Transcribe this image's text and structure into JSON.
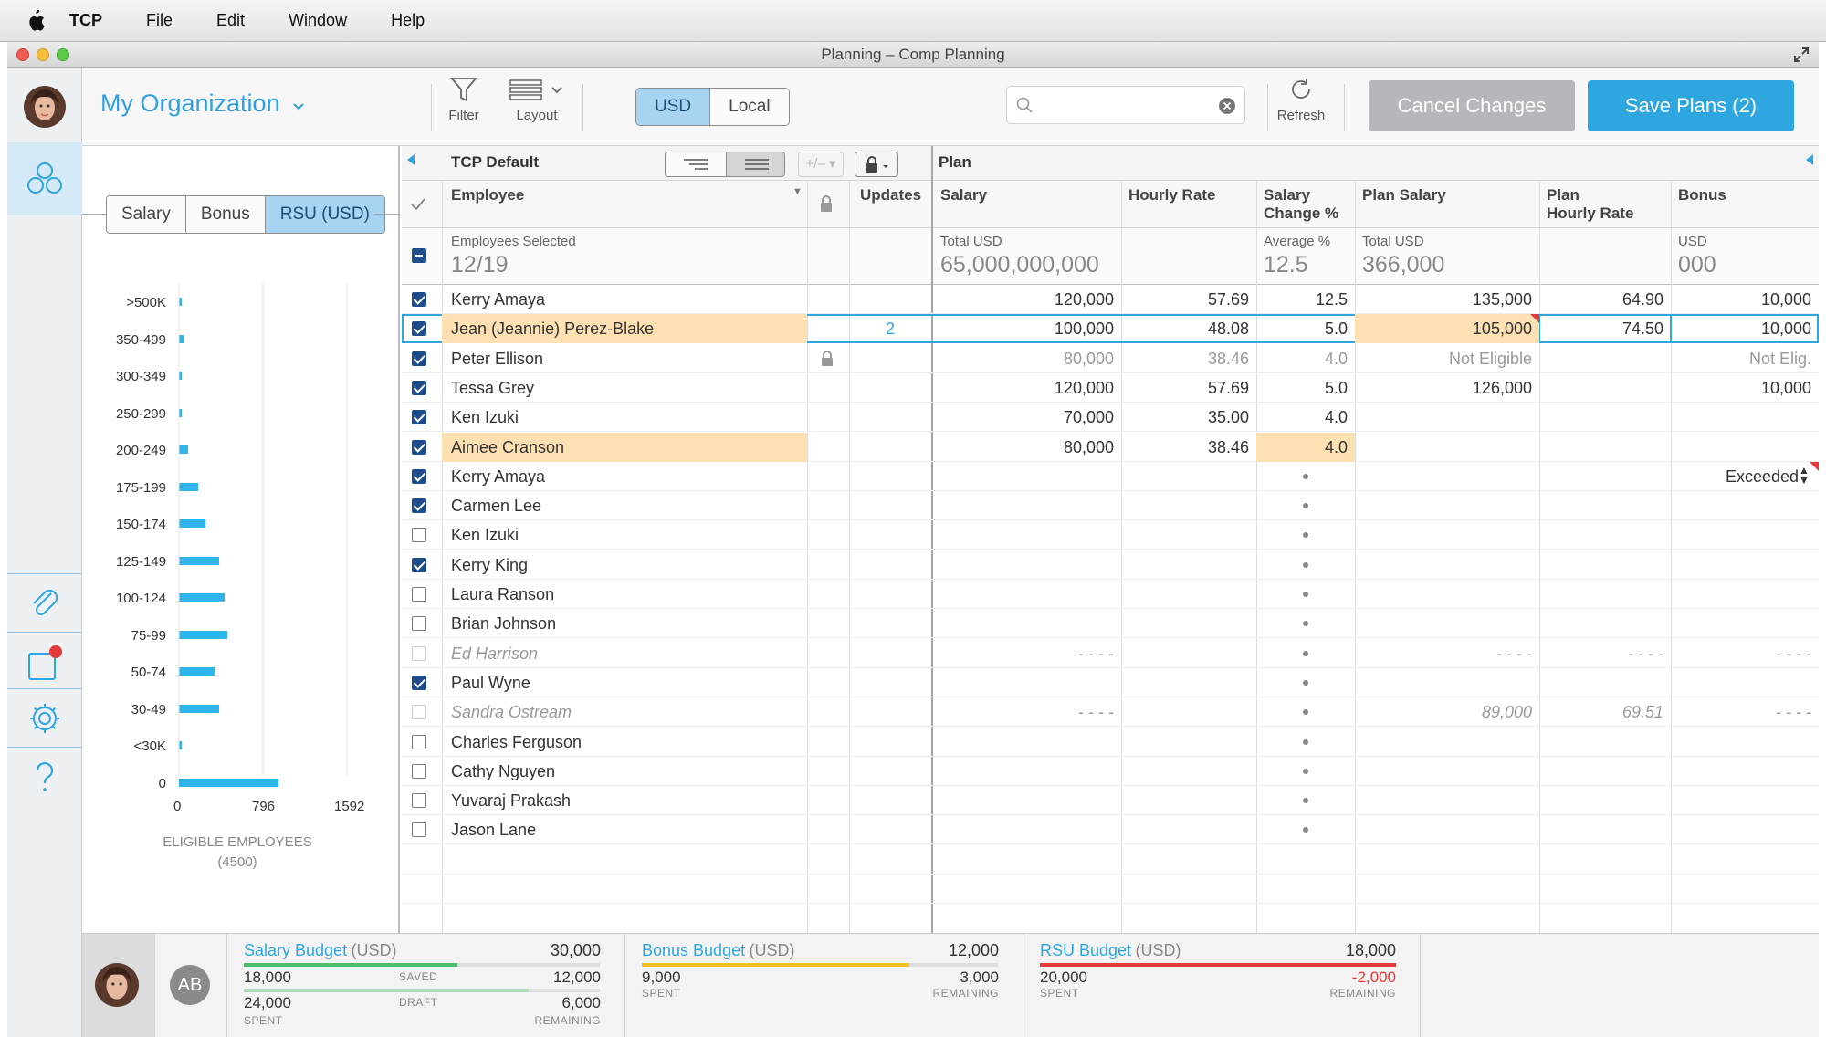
{
  "menubar": {
    "app": "TCP",
    "items": [
      "File",
      "Edit",
      "Window",
      "Help"
    ]
  },
  "window": {
    "title": "Planning – Comp Planning"
  },
  "toolbar": {
    "org": "My Organization",
    "filter_label": "Filter",
    "layout_label": "Layout",
    "currency_usd": "USD",
    "currency_local": "Local",
    "search_placeholder": "",
    "refresh_label": "Refresh",
    "cancel_label": "Cancel Changes",
    "save_label": "Save Plans (2)"
  },
  "sidepanel": {
    "tabs": [
      "Salary",
      "Bonus",
      "RSU (USD)"
    ],
    "active_tab": "RSU (USD)",
    "histogram": [
      {
        "label": ">500K",
        "value": 12
      },
      {
        "label": "350-499",
        "value": 40
      },
      {
        "label": "300-349",
        "value": 30
      },
      {
        "label": "250-299",
        "value": 30
      },
      {
        "label": "200-249",
        "value": 90
      },
      {
        "label": "175-199",
        "value": 180
      },
      {
        "label": "150-174",
        "value": 250
      },
      {
        "label": "125-149",
        "value": 380
      },
      {
        "label": "100-124",
        "value": 430
      },
      {
        "label": "75-99",
        "value": 460
      },
      {
        "label": "50-74",
        "value": 340
      },
      {
        "label": "30-49",
        "value": 380
      },
      {
        "label": "<30K",
        "value": 30
      },
      {
        "label": "0",
        "value": 940
      }
    ],
    "axis": [
      "0",
      "796",
      "1592"
    ],
    "eligible_caption": "ELIGIBLE EMPLOYEES",
    "eligible_count": "(4500)"
  },
  "grid": {
    "left_title": "TCP Default",
    "right_title": "Plan",
    "headers": {
      "employee": "Employee",
      "updates": "Updates",
      "salary": "Salary",
      "hourly_rate": "Hourly Rate",
      "salary_change_1": "Salary",
      "salary_change_2": "Change %",
      "plan_salary": "Plan Salary",
      "plan_hourly_1": "Plan",
      "plan_hourly_2": "Hourly Rate",
      "bonus": "Bonus"
    },
    "summary": {
      "employees_label": "Employees Selected",
      "employees_value": "12/19",
      "salary_label": "Total USD",
      "salary_value": "65,000,000,000",
      "change_label": "Average %",
      "change_value": "12.5",
      "plan_label": "Total USD",
      "plan_value": "366,000",
      "bonus_label": "USD",
      "bonus_value": "000"
    },
    "rows": [
      {
        "checked": true,
        "name": "Kerry Amaya",
        "updates": "",
        "salary": "120,000",
        "hourly": "57.69",
        "change": "12.5",
        "plan_salary": "135,000",
        "plan_hourly": "64.90",
        "bonus": "10,000"
      },
      {
        "checked": true,
        "name": "Jean (Jeannie) Perez-Blake",
        "updates": "2",
        "salary": "100,000",
        "hourly": "48.08",
        "change": "5.0",
        "plan_salary": "105,000",
        "plan_hourly": "74.50",
        "bonus": "10,000",
        "selected": true,
        "highlight_name": true,
        "highlight_plan": true
      },
      {
        "checked": true,
        "name": "Peter Ellison",
        "locked": true,
        "salary": "80,000",
        "hourly": "38.46",
        "change": "4.0",
        "plan_salary": "Not Eligible",
        "plan_hourly": "",
        "bonus": "Not Elig.",
        "dim": true
      },
      {
        "checked": true,
        "name": "Tessa Grey",
        "salary": "120,000",
        "hourly": "57.69",
        "change": "5.0",
        "plan_salary": "126,000",
        "plan_hourly": "",
        "bonus": "10,000"
      },
      {
        "checked": true,
        "name": "Ken Izuki",
        "salary": "70,000",
        "hourly": "35.00",
        "change": "4.0",
        "plan_salary": "",
        "plan_hourly": "",
        "bonus": ""
      },
      {
        "checked": true,
        "name": "Aimee Cranson",
        "salary": "80,000",
        "hourly": "38.46",
        "change": "4.0",
        "plan_salary": "",
        "plan_hourly": "",
        "bonus": "",
        "highlight_name": true,
        "highlight_change": true
      },
      {
        "checked": true,
        "name": "Kerry Amaya",
        "dot": true,
        "bonus": "Exceeded"
      },
      {
        "checked": true,
        "name": "Carmen Lee",
        "dot": true
      },
      {
        "checked": false,
        "name": "Ken Izuki",
        "dot": true
      },
      {
        "checked": true,
        "name": "Kerry King",
        "dot": true
      },
      {
        "checked": false,
        "name": "Laura Ranson",
        "dot": true
      },
      {
        "checked": false,
        "name": "Brian Johnson",
        "dot": true
      },
      {
        "checked": false,
        "name": "Ed Harrison",
        "inactive": true,
        "dot": true,
        "salary": "- - - -",
        "plan_salary": "- - - -",
        "plan_hourly": "- - - -",
        "bonus": "- - - -"
      },
      {
        "checked": true,
        "name": "Paul Wyne",
        "dot": true
      },
      {
        "checked": false,
        "name": "Sandra Ostream",
        "inactive": true,
        "dot": true,
        "salary": "- - - -",
        "plan_salary": "89,000",
        "plan_hourly": "69.51",
        "bonus": "- - - -"
      },
      {
        "checked": false,
        "name": "Charles Ferguson",
        "dot": true
      },
      {
        "checked": false,
        "name": "Cathy Nguyen",
        "dot": true
      },
      {
        "checked": false,
        "name": "Yuvaraj Prakash",
        "dot": true
      },
      {
        "checked": false,
        "name": "Jason Lane",
        "dot": true
      }
    ]
  },
  "footer": {
    "user_initials": "AB",
    "salary": {
      "title": "Salary Budget",
      "unit": "(USD)",
      "total": "30,000",
      "spent_top": "18,000",
      "saved_label": "SAVED",
      "remaining_top": "12,000",
      "spent_bottom": "24,000",
      "draft_label": "DRAFT",
      "remaining_bottom": "6,000",
      "spent_cap": "SPENT",
      "remaining_cap": "REMAINING",
      "color": "#4cbf6a",
      "progress": 0.6,
      "draft_progress": 0.8
    },
    "bonus": {
      "title": "Bonus Budget",
      "unit": "(USD)",
      "total": "12,000",
      "spent": "9,000",
      "remaining": "3,000",
      "spent_cap": "SPENT",
      "remaining_cap": "REMAINING",
      "color": "#f3c322",
      "progress": 0.75
    },
    "rsu": {
      "title": "RSU Budget",
      "unit": "(USD)",
      "total": "18,000",
      "spent": "20,000",
      "remaining": "-2,000",
      "spent_cap": "SPENT",
      "remaining_cap": "REMAINING",
      "color": "#e63a3a",
      "progress": 1.0
    }
  },
  "colors": {
    "accent": "#2ea7e0",
    "highlight": "#fde1b3",
    "selected_tab": "#a8d4f2"
  }
}
